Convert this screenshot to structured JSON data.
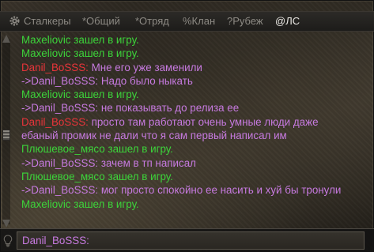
{
  "tabs": [
    {
      "label": "Сталкеры",
      "active": false
    },
    {
      "label": "Общий",
      "prefix": "*",
      "active": false
    },
    {
      "label": "Отряд",
      "prefix": "*",
      "active": false
    },
    {
      "label": "Клан",
      "prefix": "%",
      "active": false
    },
    {
      "label": "Рубеж",
      "prefix": "?",
      "active": false
    },
    {
      "label": "ЛС",
      "prefix": "@",
      "active": true
    }
  ],
  "tab_text": {
    "t0": "Сталкеры",
    "t1": "*Общий",
    "t2": "*Отряд",
    "t3": "%Клан",
    "t4": "?Рубеж",
    "t5": "@ЛС"
  },
  "messages": [
    {
      "text": "Maxeliovic зашел в игру."
    },
    {
      "text": "Maxeliovic зашел в игру."
    },
    {
      "sender": "Danil_BoSSS:",
      "text": " Мне его уже заменили"
    },
    {
      "text": "->Danil_BoSSS: Надо было ныкать"
    },
    {
      "text": "Maxeliovic зашел в игру."
    },
    {
      "text": "->Danil_BoSSS: не показывать до релиза ее"
    },
    {
      "sender": "Danil_BoSSS:",
      "text": " просто там работают очень умные люди даже ебаный промик не дали что я сам первый написал им"
    },
    {
      "text": "Плюшевое_мясо зашел в игру."
    },
    {
      "text": "->Danil_BoSSS: зачем в тп написал"
    },
    {
      "text": "Плюшевое_мясо зашел в игру."
    },
    {
      "text": "->Danil_BoSSS: мог просто спокойно ее насить и хуй бы тронули"
    },
    {
      "text": "Maxeliovic зашел в игру."
    }
  ],
  "input": {
    "value": "Danil_BoSSS:"
  },
  "colors": {
    "system": "#3cd43a",
    "private": "#c77ae0",
    "sender": "#e8343a"
  },
  "icons": {
    "settings": "gear-icon",
    "hint": "lightbulb-icon",
    "scroll_up": "arrow-up-icon",
    "scroll_down": "arrow-down-icon"
  }
}
